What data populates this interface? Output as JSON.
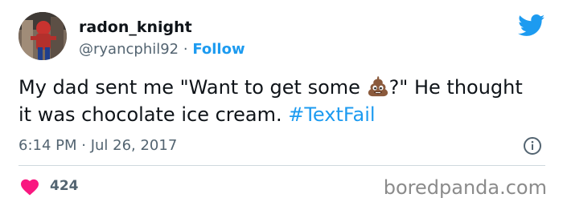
{
  "author": {
    "name": "radon_knight",
    "handle": "@ryancphil92",
    "separator": " · ",
    "follow_label": "Follow"
  },
  "tweet": {
    "text_before_emoji": "My dad sent me \"Want to get some ",
    "emoji": "poop-emoji",
    "text_after_emoji": "?\" He thought it was chocolate ice cream. ",
    "hashtag": "#TextFail",
    "timestamp": "6:14 PM · Jul 26, 2017"
  },
  "engagement": {
    "likes": "424"
  },
  "watermark": "boredpanda.com",
  "colors": {
    "accent": "#1d9bf0",
    "heart": "#f91880",
    "muted": "#536471",
    "text": "#0f1419"
  },
  "icons": {
    "brand": "twitter-bird-icon",
    "info": "info-icon",
    "like": "heart-icon"
  }
}
